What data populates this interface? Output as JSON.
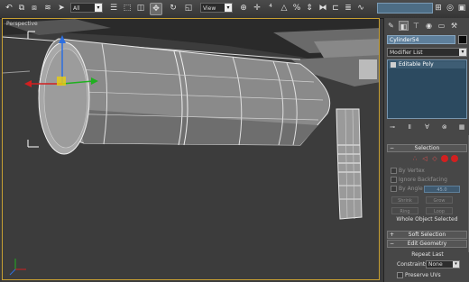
{
  "toolbar": {
    "selection_filter": "All",
    "reference_coord": "View",
    "buttons": [
      {
        "name": "undo-icon",
        "glyph": "↶"
      },
      {
        "name": "link-icon",
        "glyph": "⧉"
      },
      {
        "name": "unlink-icon",
        "glyph": "⧈"
      },
      {
        "name": "bind-spacewarp-icon",
        "glyph": "≋"
      },
      {
        "name": "select-object-icon",
        "glyph": "➤"
      },
      {
        "name": "select-by-name-icon",
        "glyph": "☰"
      },
      {
        "name": "rect-selection-icon",
        "glyph": "⬚"
      },
      {
        "name": "window-crossing-icon",
        "glyph": "◫"
      },
      {
        "name": "select-move-icon",
        "glyph": "✥"
      },
      {
        "name": "select-rotate-icon",
        "glyph": "↻"
      },
      {
        "name": "select-scale-icon",
        "glyph": "◱"
      },
      {
        "name": "pivot-icon",
        "glyph": "⊕"
      },
      {
        "name": "select-manipulate-icon",
        "glyph": "✛"
      },
      {
        "name": "snaps-icon",
        "glyph": "⁴"
      },
      {
        "name": "angle-snap-icon",
        "glyph": "△"
      },
      {
        "name": "percent-snap-icon",
        "glyph": "%"
      },
      {
        "name": "spinner-snap-icon",
        "glyph": "⇕"
      },
      {
        "name": "mirror-icon",
        "glyph": "⧓"
      },
      {
        "name": "align-icon",
        "glyph": "⊏"
      },
      {
        "name": "layer-manager-icon",
        "glyph": "≣"
      },
      {
        "name": "curve-editor-icon",
        "glyph": "∿"
      },
      {
        "name": "schematic-view-icon",
        "glyph": "⊞"
      },
      {
        "name": "material-editor-icon",
        "glyph": "◎"
      },
      {
        "name": "render-setup-icon",
        "glyph": "▣"
      },
      {
        "name": "render-icon",
        "glyph": "▶"
      }
    ]
  },
  "viewport": {
    "label": "Perspective"
  },
  "command_panel": {
    "object_name": "Cylinder54",
    "object_color": "#0a0a0a",
    "modifier_list": "Modifier List",
    "stack_item": "Editable Poly",
    "selection_rollout": "Selection",
    "checkboxes": [
      "By Vertex",
      "Ignore Backfacing",
      "By Angle"
    ],
    "angle_value": "45.0",
    "grow_shrink": [
      "Shrink",
      "Grow"
    ],
    "ring_loop": [
      "Ring",
      "Loop"
    ],
    "selection_status": "Whole Object Selected",
    "soft_selection": "Soft Selection",
    "edit_geometry": "Edit Geometry",
    "repeat_last": "Repeat Last",
    "constraints_label": "Constraints:",
    "constraints_value": "None",
    "preserve_uvs": "Preserve UVs"
  },
  "colors": {
    "viewport_border": "#c8a032",
    "active_stack": "#3e5d74",
    "object_name_bg": "#5e7f9b",
    "accent_red": "#d12020"
  }
}
